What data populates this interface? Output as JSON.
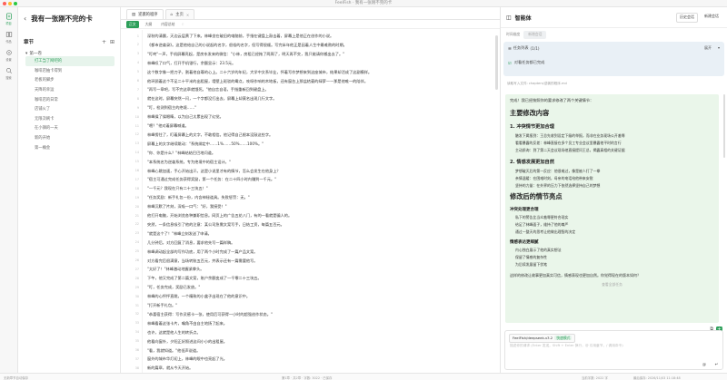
{
  "window": {
    "title": "FeelFish · 我有一张刚不完的卡"
  },
  "colors": {
    "accent": "#2d9f5a",
    "task_bg": "#e9f0f6",
    "answer_bg": "#eaf6ea"
  },
  "rail": {
    "items": [
      {
        "icon": "document-icon",
        "label": "项目"
      },
      {
        "icon": "book-icon",
        "label": "作品"
      },
      {
        "icon": "gear-icon",
        "label": "设置"
      },
      {
        "icon": "search-icon",
        "label": "搜索"
      }
    ]
  },
  "project": {
    "title": "我有一张刚不完的卡",
    "section_label": "章节",
    "folder": "第一卷",
    "chapters": [
      "打工当了网吧的",
      "咖啡店抽卡得到",
      "老板的脚步",
      "天降的幸运",
      "咖啡店的日常",
      "店铺火了",
      "无限次刷卡",
      "在小镇的一天",
      "新的开始",
      "第一桶金"
    ]
  },
  "editor": {
    "tabs": [
      {
        "label": "逆袭的程序"
      },
      {
        "label": "主页"
      }
    ],
    "toolbar": {
      "mode_text": "正文",
      "mode_outline": "大纲",
      "mode_summary": "内容总结"
    },
    "paragraphs": [
      "深秋的清晨，天边云层黄了下来。林峰坐在破旧的电脑前，手指在键盘上敲击着，屏幕上是他正在创作的小说。",
      "《都市逆袭录》。这是他给自己的小说起的名字，很俗的名字，但写得很顺。写完半年他正是因着人生中最难熬的时期。",
      "\"叮咚\"一声，手机屏幕亮起，是房东发来的微信：\"小林，房租已经拖了两周了，明天再不交，我只能请你搬出去了。\"",
      "林峰叹了口气，打开手机银行，余额显示：23.5元。",
      "这个数字像一把刀子，割着他自尊的心上。二十六岁的年纪，大学中文系毕业，怀着写作梦想来到这座城市，结果却活成了这副模样。",
      "他环顾着这个不足二十平米的出租屋，墙壁上斑驳的霉点，吱呀作响的木地板，还有窗台上那盆枯萎的绿萝——那是他唯一的陪伴。",
      "\"再写一章吧，写不完这章就饿死。\"他自言自语，手指重新回到键盘上。",
      "就在这时，屏幕突然一闪，一个字都没打出去，屏幕上却莫名出现几行文字。",
      "\"叮，检测到宿主的绝境……\"",
      "林峰揉了揉眼睛，以为自己太累出现了幻觉。",
      "\"喂？\"他对着屏幕喊道。",
      "林峰愣住了，盯着屏幕上的文字，不敢相信。他记得自己根本没敲这些字。",
      "屏幕上的文字继续跳动：\"系统绑定中……1%……50%……100%。\"",
      "\"你、你是什么？\"林峰结结巴巴地问道。",
      "\"本系统名为逆袭系统，专为绝境中的宿主设计。\"",
      "林峰心跳加速，手心开始出汗。这是小说里才有的情节，怎么会发生在他身上？",
      "\"宿主可通过完成任务获得奖励，第一个任务：在二十四小时内赚到一千元。\"",
      "\"一千元？我现在只有二十三块五！\"",
      "\"任务奖励：新手礼包一份，内含神秘道具。失败惩罚：无。\"",
      "林峰沉默了片刻，深吸一口气：\"好，我接受！\"",
      "他打开电脑，开始浏览各种兼职信息。网页上的广告五花八门，有的一看就是骗人的。",
      "突然，一条信息吸引了他的注意：某公司急需文案写手，日结工资，每篇五百元。",
      "\"就是这个了！\"林峰立刻发送了申请。",
      "几分钟后，对方回复了消息，要求他先写一篇样稿。",
      "林峰调动起全部的写作功底，用了两个小时完成了一篇产品文案。",
      "对方看完后很满意，当场转账五百元，并表示还有一篇需要他写。",
      "\"太好了！\"林峰激动地握紧拳头。",
      "下午，他又完成了第二篇文案，账户余额变成了一千零二十三块五。",
      "\"叮，任务完成，奖励已发放。\"",
      "林峰的心怦怦直跳，一个精致的小盒子出现在了他的意识中。",
      "\"打开新手礼包。\"",
      "\"恭喜宿主获得：写作灵感卡一张，使用后可获得一小时的超强创作状态。\"",
      "林峰看着这张卡片，嘴角不由自主地扬了起来。",
      "也许，这就是他人生的转折点。",
      "他看向窗外，夕阳正好照进这间小小的出租屋。",
      "\"看，我就知道。\"他低声说道。",
      "窗外的城市华灯初上，林峰的眼中也亮起了光。",
      "新的篇章，就从今天开始。",
      "他重新坐到电脑前，手指落在键盘上。",
      "\"好的，下一章。\"他笑了。"
    ]
  },
  "agent": {
    "title": "智能体",
    "history_btn": "历史会话",
    "new_btn": "新建会话",
    "ctx_label": "时间维度",
    "ctx_value": "新增会话",
    "task": {
      "label": "任务列表",
      "count": "(1/1)",
      "expand": "展开",
      "item": "对看任务都已完成"
    },
    "file_line": "读取写入文件: chapters/逆袭的程序.md",
    "answer": {
      "intro": "完成！我已经按照你的要求修改了两个关键情节：",
      "h_main": "主要修改内容",
      "s1": "1. 冲突情节更加合理",
      "s1_items": [
        "触发下属报到：王总先收到设定下级的举报，而非在业务现场公开羞辱",
        "看看暴露的反差：林峰直接在多个员工专业会议里暴露他平时的言行",
        "主动质询：到了第二天会议现场他直接提问王总，揭露真相的关键证据"
      ],
      "s2": "2. 情感发展更加自然",
      "s2_items": [
        "梦想破灭后的第一反应：他很难过，像是被人打了一拳",
        "亲情温暖：在困难时刻，母亲的电话给他带来安慰",
        "坚持的力量：在外界的压力下依然选择坚持自己的梦想"
      ],
      "h_after": "修改后的情节亮点",
      "g1": "冲突处理更合理",
      "g1_items": [
        "私下的警告比当众羞辱更符合现实",
        "给足了林峰面子，维持了他的尊严",
        "通过一整天的思考让他做出理智的决定"
      ],
      "g2": "情感表达更细腻",
      "g2_items": [
        "内心独白展示了他的真实想法",
        "保留了情感的复杂性",
        "为后续发展留下伏笔"
      ],
      "question": "这样的修改让故事更加真实可信，情感表现也更加自然。你觉得现在的版本如何？",
      "more": "查看全部任务"
    },
    "composer": {
      "model": "FeelFish/deepseek-v3.2",
      "model_tag": "快速模式",
      "placeholder": "描述你的请求 (Enter 发送，Shift + Enter 换行，@ 引用章节，/ 调用命令)",
      "attach": "@",
      "send": "↵"
    }
  },
  "statusbar": {
    "left": "无新章节自动保存",
    "center": "第1章 · 共2章 · 字数: 3022 · 已保存",
    "right1": "当前字数: 2022 字",
    "right2": "最后保存: 2026/11/03 11:18:48"
  }
}
